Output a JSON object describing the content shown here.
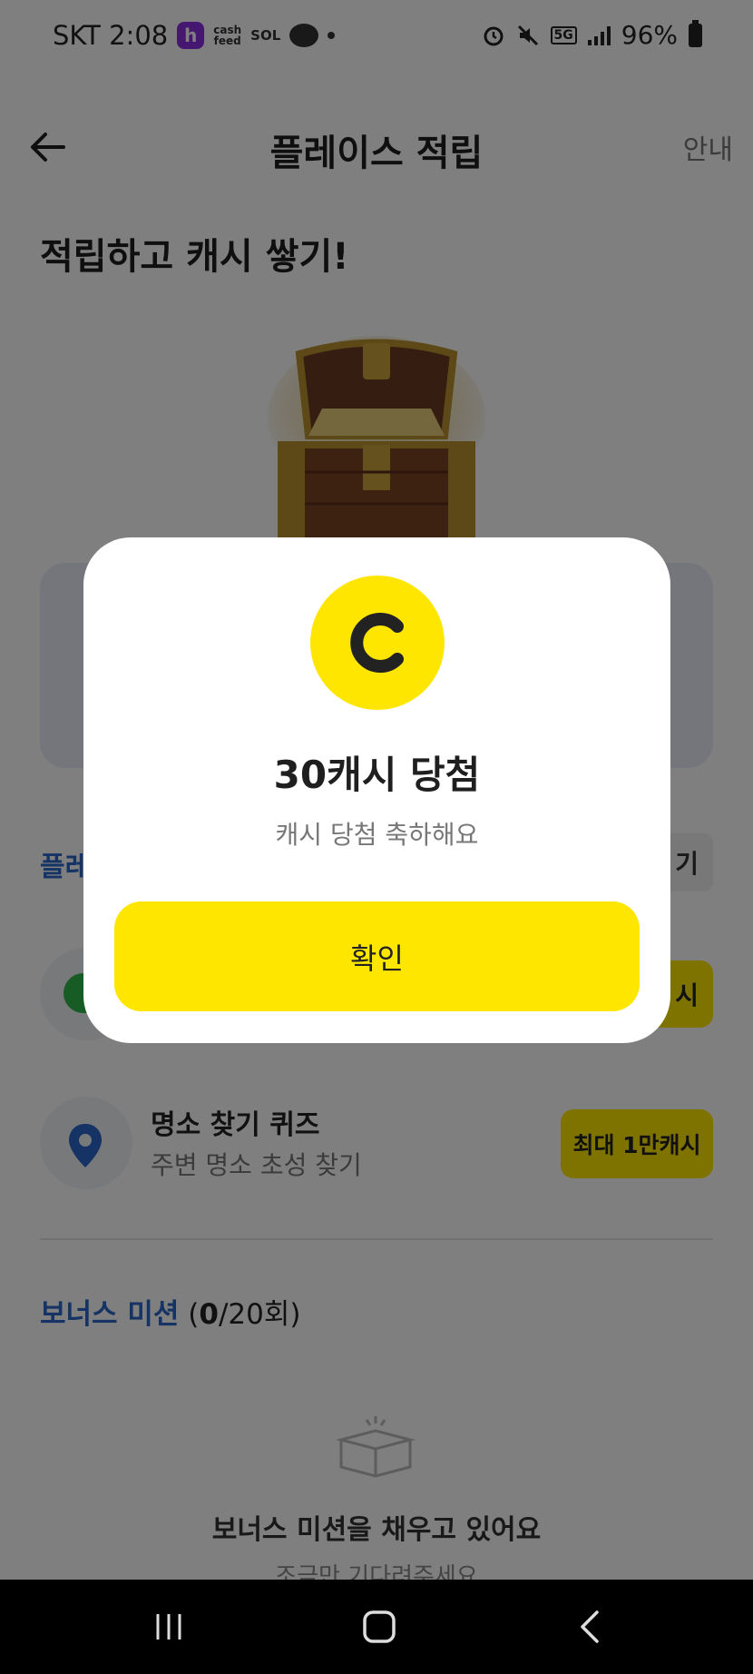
{
  "status_bar": {
    "carrier_time": "SKT 2:08",
    "app_icons": [
      "h",
      "cash feed",
      "SOL Bank"
    ],
    "app_icon_cash_line1": "cash",
    "app_icon_cash_line2": "feed",
    "app_icon_sol": "SOL",
    "network": "5G",
    "battery": "96%"
  },
  "header": {
    "title": "플레이스 적립",
    "right_link": "안내"
  },
  "main": {
    "headline": "적립하고 캐시 쌓기!",
    "place_label": "플레",
    "right_chip": "기",
    "row_button": "시",
    "quiz": {
      "title": "명소 찾기 퀴즈",
      "subtitle": "주변 명소 초성 찾기",
      "button": "최대 1만캐시"
    },
    "bonus": {
      "label": "보너스 미션",
      "count": "0",
      "total": "/20회)",
      "open": "("
    },
    "empty_state": {
      "title": "보너스 미션을 채우고 있어요",
      "subtitle": "조금만 기다려주세요"
    }
  },
  "modal": {
    "coin_letter": "C",
    "title": "30캐시 당첨",
    "subtitle": "캐시 당첨 축하해요",
    "confirm_label": "확인"
  },
  "colors": {
    "accent_yellow": "#ffe600",
    "link_blue": "#2a66c9",
    "green": "#2eb84a"
  }
}
